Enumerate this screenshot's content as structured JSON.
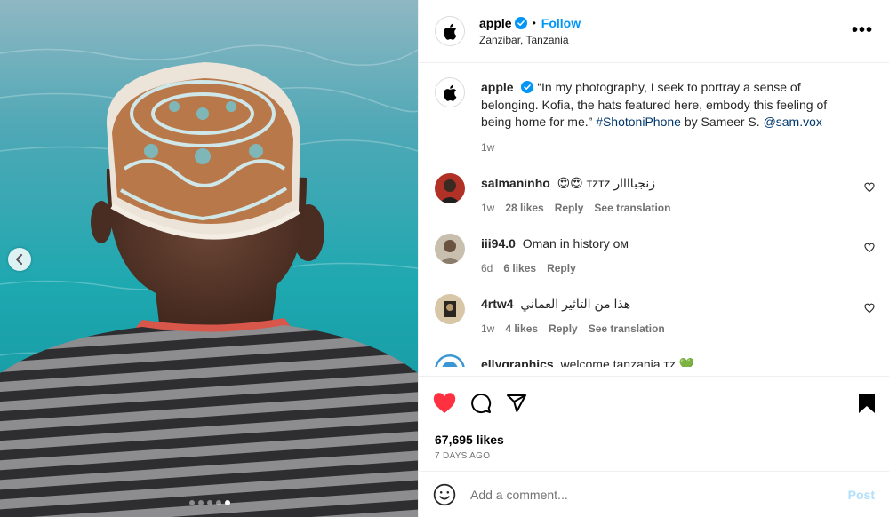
{
  "header": {
    "username": "apple",
    "follow_label": "Follow",
    "separator": "•",
    "location": "Zanzibar, Tanzania",
    "more_label": "•••"
  },
  "caption": {
    "username": "apple",
    "text": "“In my photography, I seek to portray a sense of belonging. Kofia, the hats featured here, embody this feeling of being home for me.”",
    "hashtag": "#ShotoniPhone",
    "by_text": "by Sameer S.",
    "mention": "@sam.vox",
    "time": "1w"
  },
  "comments": [
    {
      "username": "salmaninho",
      "text": "😍😍 ᴛᴢᴛᴢ زنجباااار",
      "time": "1w",
      "likes": "28 likes",
      "reply": "Reply",
      "translate": "See translation"
    },
    {
      "username": "iii94.0",
      "text": "Oman in history ᴏᴍ",
      "time": "6d",
      "likes": "6 likes",
      "reply": "Reply",
      "translate": ""
    },
    {
      "username": "4rtw4",
      "text": "هذا من التاثير العماني",
      "time": "1w",
      "likes": "4 likes",
      "reply": "Reply",
      "translate": "See translation"
    },
    {
      "username": "ellygraphics",
      "text": "welcome tanzania ᴛᴢ 💚"
    }
  ],
  "likes_text": "67,695 likes",
  "date_text": "7 DAYS AGO",
  "add_comment": {
    "placeholder": "Add a comment...",
    "post_label": "Post"
  },
  "carousel": {
    "total": 5,
    "active": 5
  },
  "colors": {
    "accent": "#0095f6",
    "like_red": "#ff3040",
    "link": "#00376b"
  }
}
